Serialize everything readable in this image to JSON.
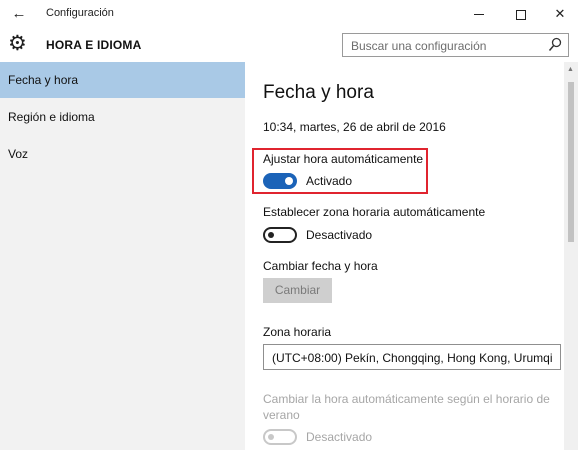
{
  "window": {
    "title": "Configuración",
    "back_glyph": "←",
    "controls": [
      "minimize",
      "maximize",
      "close"
    ],
    "close_glyph": "✕"
  },
  "header": {
    "section_title": "HORA E IDIOMA",
    "icon": "gear-icon",
    "search_placeholder": "Buscar una configuración"
  },
  "sidebar": {
    "items": [
      {
        "label": "Fecha y hora",
        "active": true
      },
      {
        "label": "Región e idioma",
        "active": false
      },
      {
        "label": "Voz",
        "active": false
      }
    ]
  },
  "content": {
    "title": "Fecha y hora",
    "current_datetime": "10:34, martes, 26 de abril de 2016",
    "auto_time": {
      "label": "Ajustar hora automáticamente",
      "state": "Activado",
      "on": true
    },
    "auto_timezone": {
      "label": "Establecer zona horaria automáticamente",
      "state": "Desactivado",
      "on": false
    },
    "change_datetime": {
      "label": "Cambiar fecha y hora",
      "button": "Cambiar"
    },
    "timezone": {
      "label": "Zona horaria",
      "value": "(UTC+08:00) Pekín, Chongqing, Hong Kong, Urumqi"
    },
    "dst": {
      "label": "Cambiar la hora automáticamente según el horario de verano",
      "state": "Desactivado",
      "enabled": false
    }
  },
  "colors": {
    "accent": "#1b63b8",
    "selected_nav": "#a9c9e6",
    "highlight_border": "#e0242f"
  }
}
